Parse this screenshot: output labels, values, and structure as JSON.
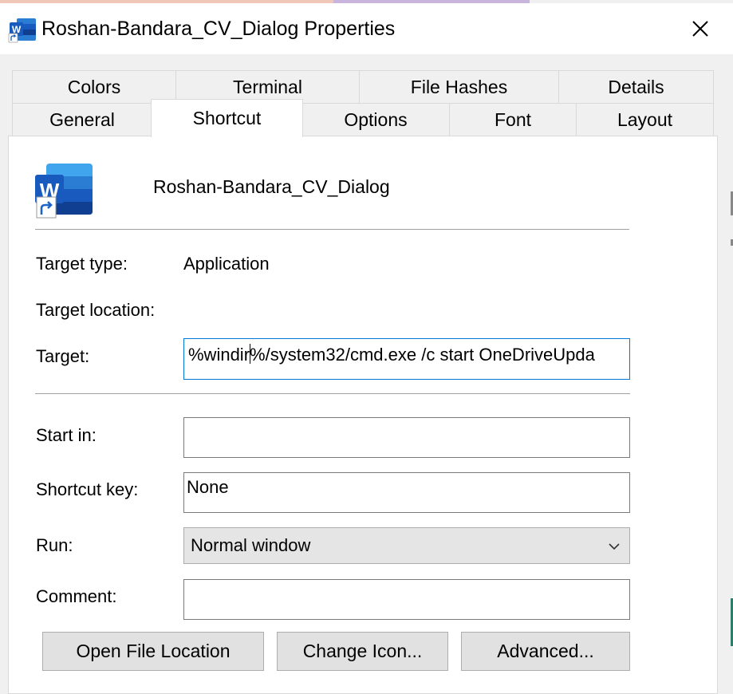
{
  "window": {
    "title": "Roshan-Bandara_CV_Dialog Properties",
    "app_icon": "word-shortcut-icon",
    "close_icon": "close-icon"
  },
  "tabs_row1": [
    {
      "label": "Colors"
    },
    {
      "label": "Terminal"
    },
    {
      "label": "File Hashes"
    },
    {
      "label": "Details"
    }
  ],
  "tabs_row2": [
    {
      "label": "General"
    },
    {
      "label": "Shortcut",
      "active": true
    },
    {
      "label": "Options"
    },
    {
      "label": "Font"
    },
    {
      "label": "Layout"
    }
  ],
  "shortcut": {
    "file_name": "Roshan-Bandara_CV_Dialog",
    "target_type_label": "Target type:",
    "target_type_value": "Application",
    "target_location_label": "Target location:",
    "target_label": "Target:",
    "target_value_before_caret": "%windir",
    "target_value_after_caret": "%/system32/cmd.exe /c start OneDriveUpda",
    "start_in_label": "Start in:",
    "start_in_value": "",
    "shortcut_key_label": "Shortcut key:",
    "shortcut_key_value": "None",
    "run_label": "Run:",
    "run_value": "Normal window",
    "comment_label": "Comment:",
    "comment_value": ""
  },
  "buttons": {
    "open_file_location": "Open File Location",
    "change_icon": "Change Icon...",
    "advanced": "Advanced..."
  },
  "colors": {
    "word_blue": "#185abd",
    "focus_border": "#0078d7"
  }
}
